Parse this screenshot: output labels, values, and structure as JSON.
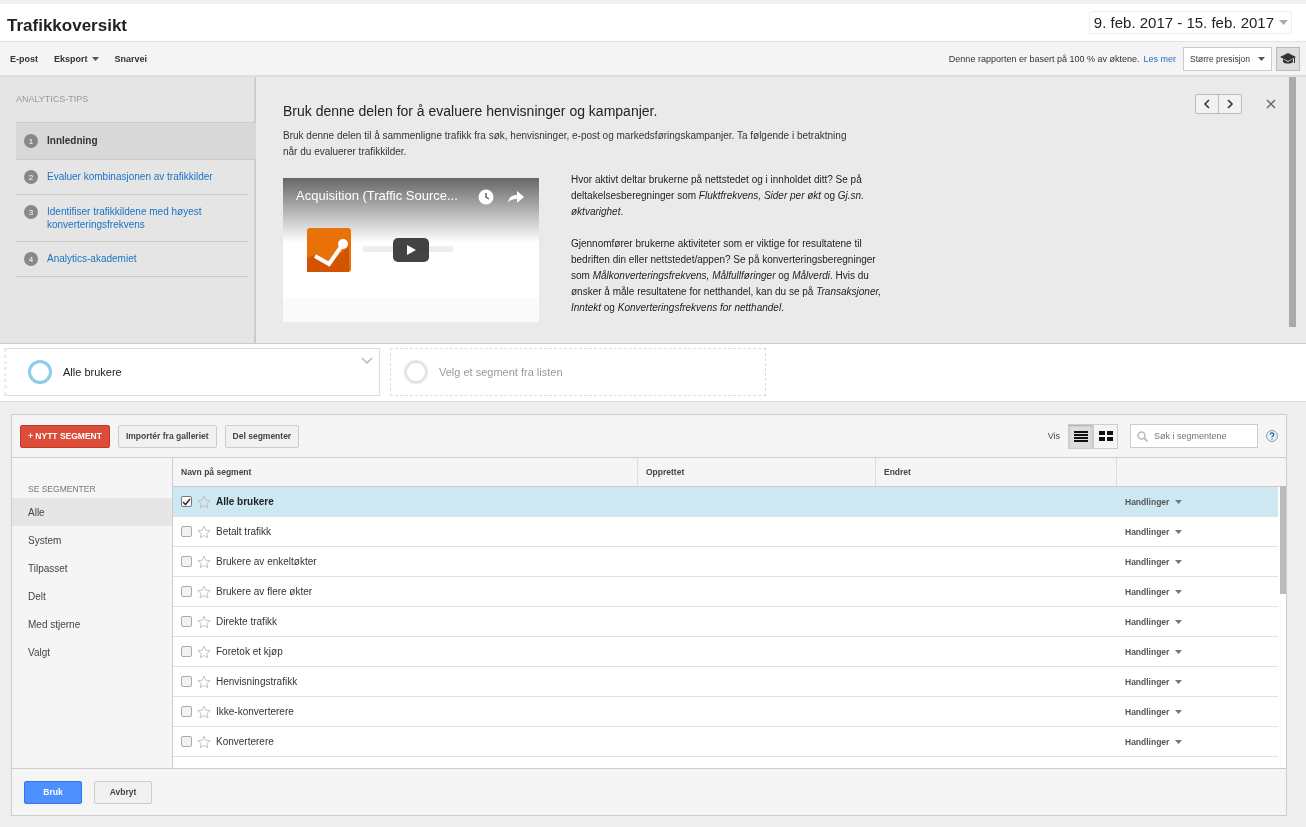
{
  "header": {
    "title": "Trafikkoversikt",
    "date_range": "9. feb. 2017 - 15. feb. 2017"
  },
  "toolbar": {
    "actions": [
      {
        "label": "E-post",
        "has_menu": false
      },
      {
        "label": "Eksport",
        "has_menu": true
      },
      {
        "label": "Snarvei",
        "has_menu": false
      }
    ],
    "sampling_note": "Denne rapporten er basert på 100 % av øktene.",
    "learn_more": "Les mer",
    "precision": "Større presisjon"
  },
  "tips": {
    "heading": "ANALYTICS-TIPS",
    "steps": [
      {
        "number": "1",
        "label": "Innledning",
        "selected": true
      },
      {
        "number": "2",
        "label": "Evaluer kombinasjonen av trafikkilder",
        "selected": false
      },
      {
        "number": "3",
        "label": "Identifiser trafikkildene med høyest konverteringsfrekvens",
        "selected": false
      },
      {
        "number": "4",
        "label": "Analytics-akademiet",
        "selected": false
      }
    ],
    "title": "Bruk denne delen for å evaluere henvisninger og kampanjer.",
    "intro": "Bruk denne delen til å sammenligne trafikk fra søk, henvisninger, e-post og markedsføringskampanjer. Ta følgende i betraktning når du evaluerer trafikkilder.",
    "video_title": "Acquisition (Traffic Source...",
    "paragraphs": [
      "Hvor aktivt deltar brukerne på nettstedet og i innholdet ditt? Se på deltakelsesberegninger som *Fluktfrekvens, Sider per økt* og *Gj.sn. øktvarighet*.",
      "Gjennomfører brukerne aktiviteter som er viktige for resultatene til bedriften din eller nettstedet/appen? Se på konverteringsberegninger som *Målkonverteringsfrekvens, Målfullføringer* og *Målverdi*. Hvis du ønsker å måle resultatene for netthandel, kan du se på *Transaksjoner, Inntekt* og *Konverteringsfrekvens for netthandel*."
    ]
  },
  "segment_bar": {
    "slots": [
      {
        "label": "Alle brukere",
        "kind": "active"
      },
      {
        "label": "Velg et segment fra listen",
        "kind": "empty"
      }
    ]
  },
  "segment_picker": {
    "buttons": [
      {
        "label": "+ NYTT SEGMENT",
        "kind": "primary"
      },
      {
        "label": "Importér fra galleriet",
        "kind": "plain"
      },
      {
        "label": "Del segmenter",
        "kind": "plain"
      }
    ],
    "view_label": "Vis",
    "views": [
      {
        "kind": "list",
        "selected": true
      },
      {
        "kind": "grid",
        "selected": false
      }
    ],
    "search": {
      "placeholder": "Søk i segmentene"
    },
    "filter_heading": "SE SEGMENTER",
    "filters": [
      {
        "label": "Alle",
        "selected": true
      },
      {
        "label": "System",
        "selected": false
      },
      {
        "label": "Tilpasset",
        "selected": false
      },
      {
        "label": "Delt",
        "selected": false
      },
      {
        "label": "Med stjerne",
        "selected": false
      },
      {
        "label": "Valgt",
        "selected": false
      }
    ],
    "columns": [
      "Navn på segment",
      "Opprettet",
      "Endret"
    ],
    "rows": [
      {
        "name": "Alle brukere",
        "checked": true,
        "selected": true,
        "actions": "Handlinger"
      },
      {
        "name": "Betalt trafikk",
        "checked": false,
        "selected": false,
        "actions": "Handlinger"
      },
      {
        "name": "Brukere av enkeltøkter",
        "checked": false,
        "selected": false,
        "actions": "Handlinger"
      },
      {
        "name": "Brukere av flere økter",
        "checked": false,
        "selected": false,
        "actions": "Handlinger"
      },
      {
        "name": "Direkte trafikk",
        "checked": false,
        "selected": false,
        "actions": "Handlinger"
      },
      {
        "name": "Foretok et kjøp",
        "checked": false,
        "selected": false,
        "actions": "Handlinger"
      },
      {
        "name": "Henvisningstrafikk",
        "checked": false,
        "selected": false,
        "actions": "Handlinger"
      },
      {
        "name": "Ikke-konverterere",
        "checked": false,
        "selected": false,
        "actions": "Handlinger"
      },
      {
        "name": "Konverterere",
        "checked": false,
        "selected": false,
        "actions": "Handlinger"
      }
    ],
    "footer_buttons": [
      {
        "label": "Bruk",
        "kind": "primary"
      },
      {
        "label": "Avbryt",
        "kind": "plain"
      }
    ]
  }
}
